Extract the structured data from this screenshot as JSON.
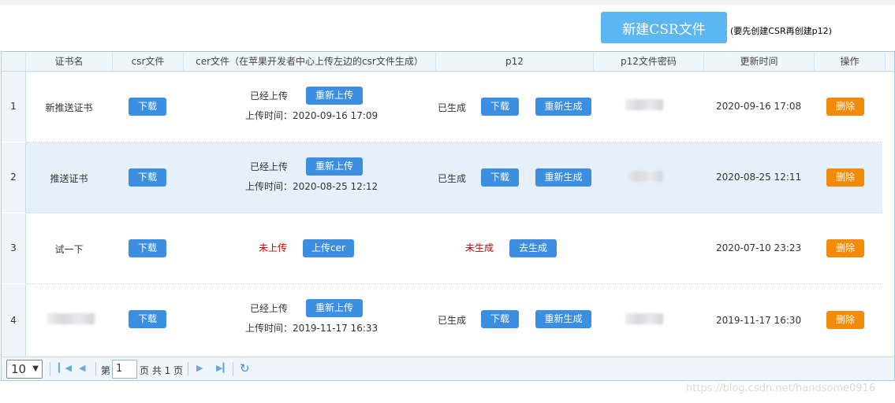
{
  "toolbar": {
    "new_button": "新建CSR文件",
    "note": "(要先创建CSR再创建p12)"
  },
  "columns": {
    "name": "证书名",
    "csr": "csr文件",
    "cer": "cer文件（在苹果开发者中心上传左边的csr文件生成）",
    "p12": "p12",
    "p12pwd": "p12文件密码",
    "updated": "更新时间",
    "action": "操作"
  },
  "rows": [
    {
      "index": "1",
      "name": "新推送证书",
      "csr_download": "下载",
      "cer_status": "已经上传",
      "cer_button": "重新上传",
      "cer_time": "上传时间：2020-09-16 17:09",
      "p12_status": "已生成",
      "p12_download": "下载",
      "p12_button": "重新生成",
      "updated": "2020-09-16 17:08",
      "delete": "删除"
    },
    {
      "index": "2",
      "name": "推送证书",
      "csr_download": "下载",
      "cer_status": "已经上传",
      "cer_button": "重新上传",
      "cer_time": "上传时间：2020-08-25 12:12",
      "p12_status": "已生成",
      "p12_download": "下载",
      "p12_button": "重新生成",
      "updated": "2020-08-25 12:11",
      "delete": "删除"
    },
    {
      "index": "3",
      "name": "试一下",
      "csr_download": "下载",
      "cer_status": "未上传",
      "cer_button": "上传cer",
      "p12_status": "未生成",
      "p12_button": "去生成",
      "updated": "2020-07-10 23:23",
      "delete": "删除"
    },
    {
      "index": "4",
      "csr_download": "下载",
      "cer_status": "已经上传",
      "cer_button": "重新上传",
      "cer_time": "上传时间：2019-11-17 16:33",
      "p12_status": "已生成",
      "p12_download": "下载",
      "p12_button": "重新生成",
      "updated": "2019-11-17 16:30",
      "delete": "删除"
    }
  ],
  "pager": {
    "page_size": "10",
    "page_prefix": "第",
    "page_value": "1",
    "page_suffix": "页 共 1 页"
  },
  "watermark": "https://blog.csdn.net/handsome0916",
  "colors": {
    "primary": "#3c8fe0",
    "new_button": "#5bb6f2",
    "danger": "#f28a0a",
    "error_text": "#d20000",
    "selected_row": "#e6f0fb"
  }
}
